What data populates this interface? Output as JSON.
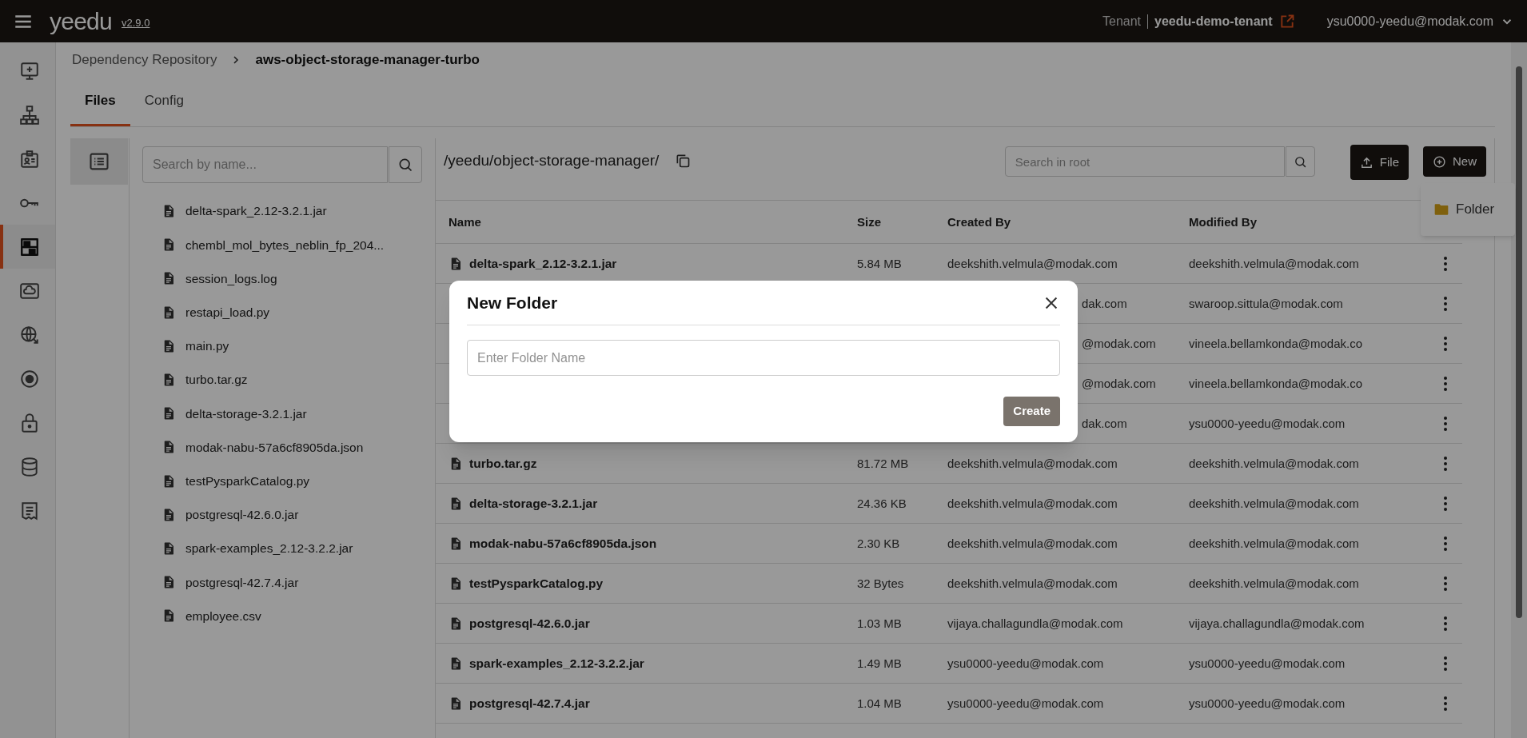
{
  "app": {
    "logo": "yeedu",
    "version": "v2.9.0",
    "tenant_label": "Tenant",
    "tenant": "yeedu-demo-tenant",
    "user": "ysu0000-yeedu@modak.com"
  },
  "nav_rail": [
    {
      "kind": "monitor",
      "selected": false
    },
    {
      "kind": "sitemap",
      "selected": false
    },
    {
      "kind": "badge",
      "selected": false
    },
    {
      "kind": "key",
      "selected": false
    },
    {
      "kind": "rack",
      "selected": true
    },
    {
      "kind": "cloud",
      "selected": false
    },
    {
      "kind": "globe",
      "selected": false
    },
    {
      "kind": "target",
      "selected": false
    },
    {
      "kind": "lock",
      "selected": false
    },
    {
      "kind": "database",
      "selected": false
    },
    {
      "kind": "receipt",
      "selected": false
    }
  ],
  "breadcrumb": [
    "Dependency Repository",
    "aws-object-storage-manager-turbo"
  ],
  "tabs": [
    {
      "label": "Files",
      "selected": true
    },
    {
      "label": "Config",
      "selected": false
    }
  ],
  "file_tree": {
    "search_placeholder": "Search by name...",
    "items": [
      "delta-spark_2.12-3.2.1.jar",
      "chembl_mol_bytes_neblin_fp_204...",
      "session_logs.log",
      "restapi_load.py",
      "main.py",
      "turbo.tar.gz",
      "delta-storage-3.2.1.jar",
      "modak-nabu-57a6cf8905da.json",
      "testPysparkCatalog.py",
      "postgresql-42.6.0.jar",
      "spark-examples_2.12-3.2.2.jar",
      "postgresql-42.7.4.jar",
      "employee.csv"
    ]
  },
  "path": "/yeedu/object-storage-manager/",
  "search": {
    "placeholder": "Search in root"
  },
  "buttons": [
    {
      "kind": "upload",
      "label": "File"
    },
    {
      "kind": "new",
      "label": "New"
    }
  ],
  "new_menu": [
    {
      "label": "Folder"
    }
  ],
  "table": {
    "columns": [
      "Name",
      "Size",
      "Created By",
      "Modified By"
    ],
    "rows": [
      {
        "kind": "full",
        "name": "delta-spark_2.12-3.2.1.jar",
        "size": "5.84 MB",
        "created_by": "deekshith.velmula@modak.com",
        "modified_by": "deekshith.velmula@modak.com"
      },
      {
        "kind": "covered",
        "created_by": "dak.com",
        "modified_by": "swaroop.sittula@modak.com"
      },
      {
        "kind": "covered",
        "created_by": "@modak.com",
        "modified_by": "vineela.bellamkonda@modak.co"
      },
      {
        "kind": "covered",
        "created_by": "@modak.com",
        "modified_by": "vineela.bellamkonda@modak.co"
      },
      {
        "kind": "covered",
        "created_by": "dak.com",
        "modified_by": "ysu0000-yeedu@modak.com"
      },
      {
        "kind": "full",
        "name": "turbo.tar.gz",
        "size": "81.72 MB",
        "created_by": "deekshith.velmula@modak.com",
        "modified_by": "deekshith.velmula@modak.com"
      },
      {
        "kind": "full",
        "name": "delta-storage-3.2.1.jar",
        "size": "24.36 KB",
        "created_by": "deekshith.velmula@modak.com",
        "modified_by": "deekshith.velmula@modak.com"
      },
      {
        "kind": "full",
        "name": "modak-nabu-57a6cf8905da.json",
        "size": "2.30 KB",
        "created_by": "deekshith.velmula@modak.com",
        "modified_by": "deekshith.velmula@modak.com"
      },
      {
        "kind": "full",
        "name": "testPysparkCatalog.py",
        "size": "32 Bytes",
        "created_by": "deekshith.velmula@modak.com",
        "modified_by": "deekshith.velmula@modak.com"
      },
      {
        "kind": "full",
        "name": "postgresql-42.6.0.jar",
        "size": "1.03 MB",
        "created_by": "vijaya.challagundla@modak.com",
        "modified_by": "vijaya.challagundla@modak.com"
      },
      {
        "kind": "full",
        "name": "spark-examples_2.12-3.2.2.jar",
        "size": "1.49 MB",
        "created_by": "ysu0000-yeedu@modak.com",
        "modified_by": "ysu0000-yeedu@modak.com"
      },
      {
        "kind": "full",
        "name": "postgresql-42.7.4.jar",
        "size": "1.04 MB",
        "created_by": "ysu0000-yeedu@modak.com",
        "modified_by": "ysu0000-yeedu@modak.com"
      }
    ]
  },
  "dialog": {
    "title": "New Folder",
    "placeholder": "Enter Folder Name",
    "button": "Create"
  }
}
